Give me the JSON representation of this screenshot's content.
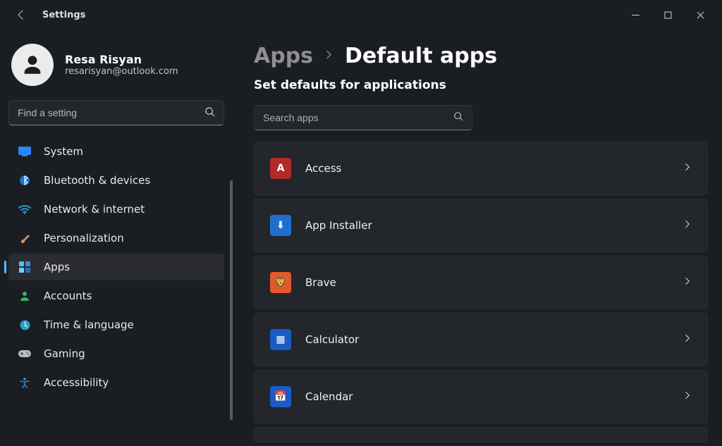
{
  "window": {
    "title": "Settings"
  },
  "user": {
    "name": "Resa Risyan",
    "email": "resarisyan@outlook.com"
  },
  "sidebar": {
    "search_placeholder": "Find a setting",
    "items": [
      {
        "label": "System",
        "icon": "system",
        "color": "#2986f5",
        "selected": false
      },
      {
        "label": "Bluetooth & devices",
        "icon": "bluetooth",
        "color": "#1f6fd0",
        "selected": false
      },
      {
        "label": "Network & internet",
        "icon": "wifi",
        "color": "#1e9bd6",
        "selected": false
      },
      {
        "label": "Personalization",
        "icon": "brush",
        "color": "#c7946b",
        "selected": false
      },
      {
        "label": "Apps",
        "icon": "grid",
        "color": "#4cc2ff",
        "selected": true
      },
      {
        "label": "Accounts",
        "icon": "person",
        "color": "#30b566",
        "selected": false
      },
      {
        "label": "Time & language",
        "icon": "clock-globe",
        "color": "#2aa0c4",
        "selected": false
      },
      {
        "label": "Gaming",
        "icon": "gamepad",
        "color": "#bcbcbc",
        "selected": false
      },
      {
        "label": "Accessibility",
        "icon": "accessibility",
        "color": "#2f7fe6",
        "selected": false
      }
    ]
  },
  "breadcrumb": {
    "parent": "Apps",
    "current": "Default apps"
  },
  "main": {
    "subtitle": "Set defaults for applications",
    "search_placeholder": "Search apps",
    "apps": [
      {
        "label": "Access",
        "icon_letter": "A",
        "icon_bg": "#b12a2a"
      },
      {
        "label": "App Installer",
        "icon_letter": "⬇",
        "icon_bg": "#1f6fd0"
      },
      {
        "label": "Brave",
        "icon_letter": "🦁",
        "icon_bg": "#e25a2a"
      },
      {
        "label": "Calculator",
        "icon_letter": "▦",
        "icon_bg": "#1a5bc5"
      },
      {
        "label": "Calendar",
        "icon_letter": "📅",
        "icon_bg": "#1a5bc5"
      }
    ]
  }
}
